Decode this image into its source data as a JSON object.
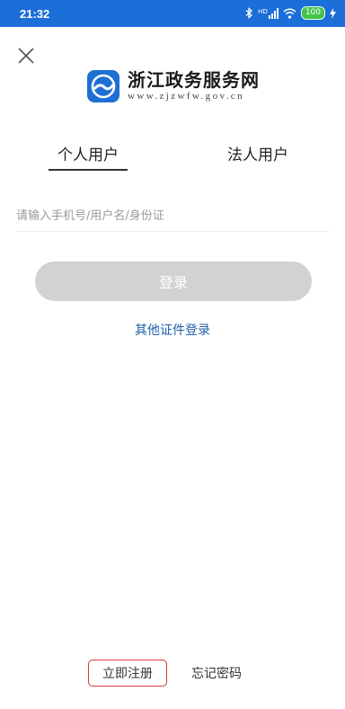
{
  "status_bar": {
    "time": "21:32",
    "signal_label": "HD",
    "battery": "100",
    "icons": [
      "bluetooth-icon",
      "signal-icon",
      "wifi-icon",
      "battery-icon",
      "charging-icon"
    ]
  },
  "header": {
    "close_icon": "close-icon"
  },
  "logo": {
    "title": "浙江政务服务网",
    "url": "www.zjzwfw.gov.cn",
    "brand_color": "#1e6fd4"
  },
  "tabs": [
    {
      "label": "个人用户",
      "active": true
    },
    {
      "label": "法人用户",
      "active": false
    }
  ],
  "form": {
    "account_placeholder": "请输入手机号/用户名/身份证",
    "account_value": "",
    "login_label": "登录",
    "login_disabled_color": "#d2d2d2"
  },
  "other_login": {
    "label": "其他证件登录",
    "color": "#1f5fa6"
  },
  "footer": {
    "register_label": "立即注册",
    "forgot_label": "忘记密码",
    "highlight_color": "#d23a3a"
  }
}
